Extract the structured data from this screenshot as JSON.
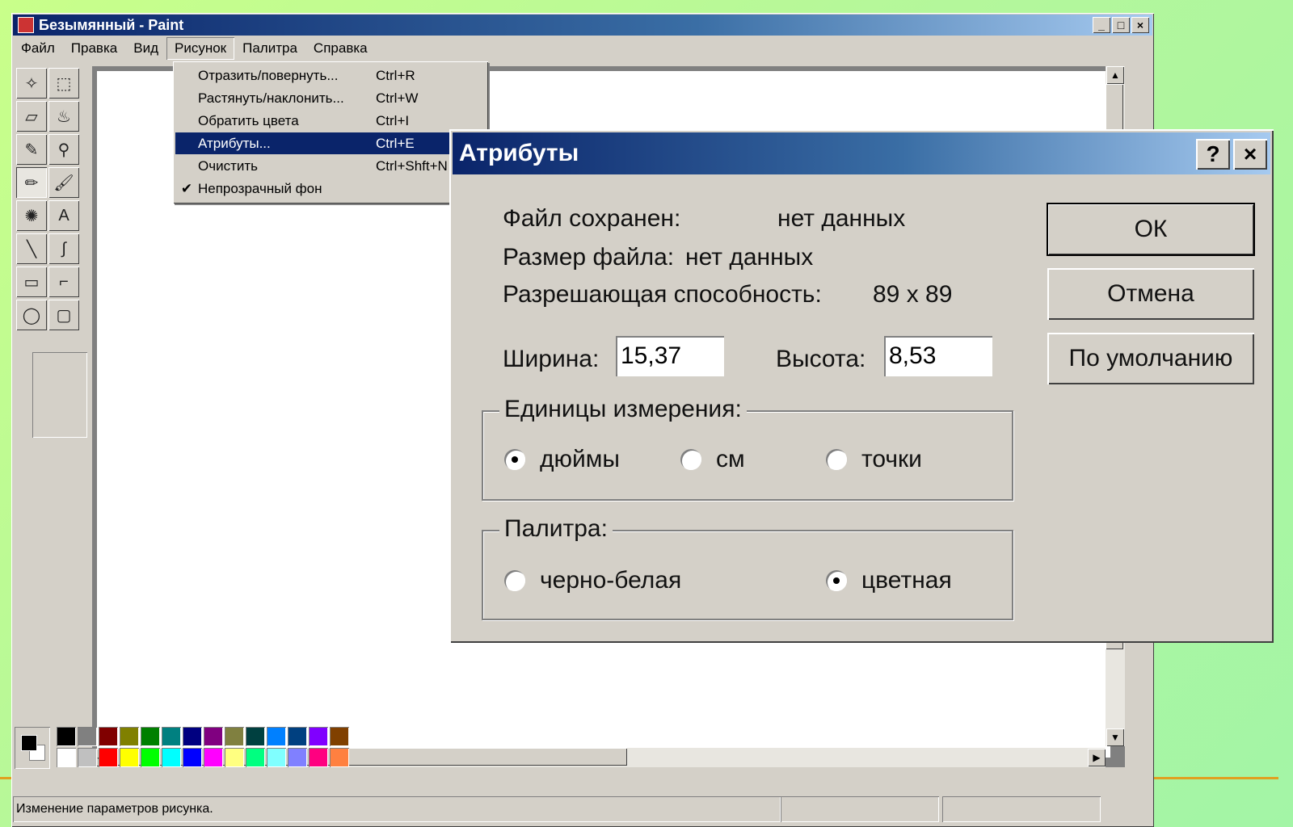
{
  "window": {
    "title": "Безымянный - Paint",
    "controls": [
      "_",
      "□",
      "×"
    ]
  },
  "menubar": [
    "Файл",
    "Правка",
    "Вид",
    "Рисунок",
    "Палитра",
    "Справка"
  ],
  "image_menu": {
    "items": [
      {
        "label": "Отразить/повернуть...",
        "shortcut": "Ctrl+R",
        "checked": false,
        "highlighted": false
      },
      {
        "label": "Растянуть/наклонить...",
        "shortcut": "Ctrl+W",
        "checked": false,
        "highlighted": false
      },
      {
        "label": "Обратить цвета",
        "shortcut": "Ctrl+I",
        "checked": false,
        "highlighted": false
      },
      {
        "label": "Атрибуты...",
        "shortcut": "Ctrl+E",
        "checked": false,
        "highlighted": true
      },
      {
        "label": "Очистить",
        "shortcut": "Ctrl+Shft+N",
        "checked": false,
        "highlighted": false
      },
      {
        "label": "Непрозрачный фон",
        "shortcut": "",
        "checked": true,
        "highlighted": false
      }
    ]
  },
  "tools": [
    {
      "name": "free-select-icon",
      "glyph": "✧"
    },
    {
      "name": "rect-select-icon",
      "glyph": "⬚"
    },
    {
      "name": "eraser-icon",
      "glyph": "▱"
    },
    {
      "name": "fill-bucket-icon",
      "glyph": "♨"
    },
    {
      "name": "color-picker-icon",
      "glyph": "✎"
    },
    {
      "name": "magnifier-icon",
      "glyph": "⚲"
    },
    {
      "name": "pencil-icon",
      "glyph": "✏"
    },
    {
      "name": "brush-icon",
      "glyph": "🖌"
    },
    {
      "name": "airbrush-icon",
      "glyph": "✺"
    },
    {
      "name": "text-icon",
      "glyph": "A"
    },
    {
      "name": "line-icon",
      "glyph": "╲"
    },
    {
      "name": "curve-icon",
      "glyph": "∫"
    },
    {
      "name": "rectangle-icon",
      "glyph": "▭"
    },
    {
      "name": "polygon-icon",
      "glyph": "⌐"
    },
    {
      "name": "ellipse-icon",
      "glyph": "◯"
    },
    {
      "name": "rounded-rect-icon",
      "glyph": "▢"
    }
  ],
  "palette": {
    "top": [
      "#000000",
      "#808080",
      "#800000",
      "#808000",
      "#008000",
      "#008080",
      "#000080",
      "#800080",
      "#808040",
      "#004040",
      "#0080ff",
      "#004080",
      "#8000ff",
      "#804000"
    ],
    "bottom": [
      "#ffffff",
      "#c0c0c0",
      "#ff0000",
      "#ffff00",
      "#00ff00",
      "#00ffff",
      "#0000ff",
      "#ff00ff",
      "#ffff80",
      "#00ff80",
      "#80ffff",
      "#8080ff",
      "#ff0080",
      "#ff8040"
    ]
  },
  "statusbar": {
    "text": "Изменение параметров рисунка."
  },
  "dialog": {
    "title": "Атрибуты",
    "help_label": "?",
    "close_label": "×",
    "file_saved_label": "Файл сохранен:",
    "file_saved_value": "нет данных",
    "file_size_label": "Размер файла:",
    "file_size_value": "нет данных",
    "resolution_label": "Разрешающая способность:",
    "resolution_value": "89 x 89",
    "width_label": "Ширина:",
    "width_value": "15,37",
    "height_label": "Высота:",
    "height_value": "8,53",
    "units_group": "Единицы измерения:",
    "units": [
      {
        "label": "дюймы",
        "selected": true
      },
      {
        "label": "см",
        "selected": false
      },
      {
        "label": "точки",
        "selected": false
      }
    ],
    "palette_group": "Палитра:",
    "palette_options": [
      {
        "label": "черно-белая",
        "selected": false
      },
      {
        "label": "цветная",
        "selected": true
      }
    ],
    "ok_label": "ОК",
    "cancel_label": "Отмена",
    "default_label": "По умолчанию"
  }
}
